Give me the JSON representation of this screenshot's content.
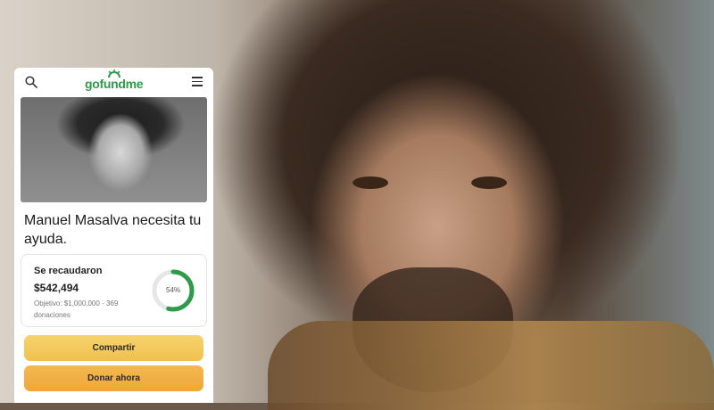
{
  "background": {
    "subject": "portrait-photo"
  },
  "card": {
    "logo_text": "gofundme",
    "brand_color": "#2f9a4a",
    "title": "Manuel Masalva necesita tu ayuda.",
    "stats": {
      "raised_label": "Se recaudaron",
      "raised_amount": "$542,494",
      "goal_text": "Objetivo: $1,000,000 · 369 donaciones",
      "progress_percent_label": "54%",
      "progress_fraction": 0.54
    },
    "share_label": "Compartir",
    "donate_label": "Donar ahora",
    "button_colors": {
      "share": "#f3c95c",
      "donate": "#efaf43"
    },
    "icons": [
      "search-icon",
      "menu-icon"
    ]
  }
}
